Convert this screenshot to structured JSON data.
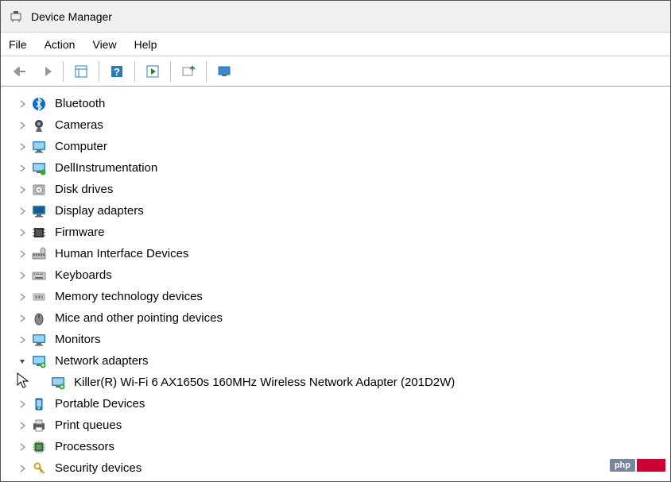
{
  "window": {
    "title": "Device Manager"
  },
  "menubar": [
    "File",
    "Action",
    "View",
    "Help"
  ],
  "tree": [
    {
      "label": "Bluetooth",
      "icon": "bluetooth",
      "state": "collapsed",
      "children": []
    },
    {
      "label": "Cameras",
      "icon": "camera",
      "state": "collapsed",
      "children": []
    },
    {
      "label": "Computer",
      "icon": "monitor",
      "state": "collapsed",
      "children": []
    },
    {
      "label": "DellInstrumentation",
      "icon": "chip-green",
      "state": "collapsed",
      "children": []
    },
    {
      "label": "Disk drives",
      "icon": "disk",
      "state": "collapsed",
      "children": []
    },
    {
      "label": "Display adapters",
      "icon": "display",
      "state": "collapsed",
      "children": []
    },
    {
      "label": "Firmware",
      "icon": "firmware",
      "state": "collapsed",
      "children": []
    },
    {
      "label": "Human Interface Devices",
      "icon": "hid",
      "state": "collapsed",
      "children": []
    },
    {
      "label": "Keyboards",
      "icon": "keyboard",
      "state": "collapsed",
      "children": []
    },
    {
      "label": "Memory technology devices",
      "icon": "memory",
      "state": "collapsed",
      "children": []
    },
    {
      "label": "Mice and other pointing devices",
      "icon": "mouse",
      "state": "collapsed",
      "children": []
    },
    {
      "label": "Monitors",
      "icon": "monitor",
      "state": "collapsed",
      "children": []
    },
    {
      "label": "Network adapters",
      "icon": "network",
      "state": "expanded",
      "children": [
        {
          "label": "Killer(R) Wi-Fi 6 AX1650s 160MHz Wireless Network Adapter (201D2W)",
          "icon": "network"
        }
      ]
    },
    {
      "label": "Portable Devices",
      "icon": "portable",
      "state": "collapsed",
      "children": []
    },
    {
      "label": "Print queues",
      "icon": "printer",
      "state": "collapsed",
      "children": []
    },
    {
      "label": "Processors",
      "icon": "cpu",
      "state": "collapsed",
      "children": []
    },
    {
      "label": "Security devices",
      "icon": "security",
      "state": "collapsed",
      "children": []
    }
  ],
  "watermark": {
    "php": "php"
  }
}
